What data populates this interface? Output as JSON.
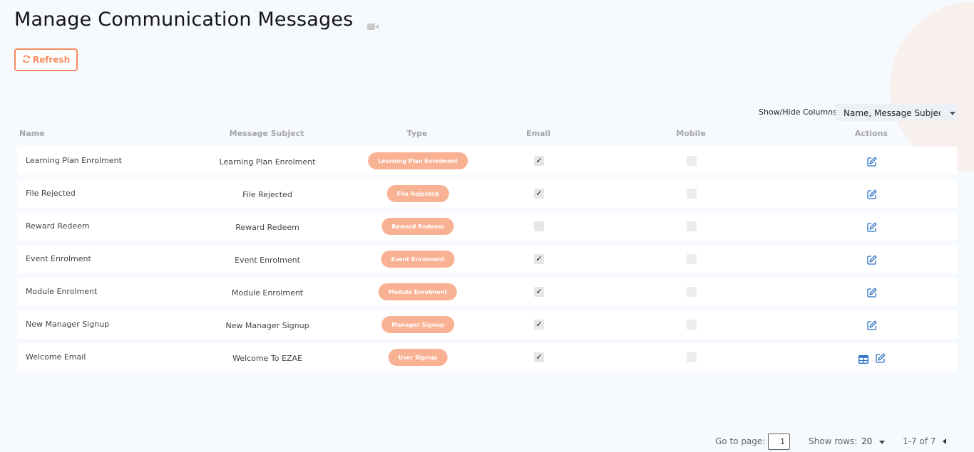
{
  "page": {
    "title": "Manage Communication Messages",
    "title_icon": "video-camera-icon",
    "refresh_label": "Refresh",
    "refresh_icon": "refresh-icon"
  },
  "columns_control": {
    "label": "Show/Hide Columns:",
    "selected": "Name, Message Subject, Ty"
  },
  "table": {
    "headers": [
      "Name",
      "Message Subject",
      "Type",
      "Email",
      "Mobile",
      "Actions"
    ],
    "rows": [
      {
        "name": "Learning Plan Enrolment",
        "subject": "Learning Plan Enrolment",
        "type": "Learning Plan Enrolment",
        "email": true,
        "mobile": false,
        "actions": [
          "edit-icon"
        ]
      },
      {
        "name": "File Rejected",
        "subject": "File Rejected",
        "type": "File Rejected",
        "email": true,
        "mobile": false,
        "actions": [
          "edit-icon"
        ]
      },
      {
        "name": "Reward Redeem",
        "subject": "Reward Redeem",
        "type": "Reward Redeem",
        "email": false,
        "mobile": false,
        "actions": [
          "edit-icon"
        ]
      },
      {
        "name": "Event Enrolment",
        "subject": "Event Enrolment",
        "type": "Event Enrolment",
        "email": true,
        "mobile": false,
        "actions": [
          "edit-icon"
        ]
      },
      {
        "name": "Module Enrolment",
        "subject": "Module Enrolment",
        "type": "Module Enrolment",
        "email": true,
        "mobile": false,
        "actions": [
          "edit-icon"
        ]
      },
      {
        "name": "New Manager Signup",
        "subject": "New Manager Signup",
        "type": "Manager Signup",
        "email": true,
        "mobile": false,
        "actions": [
          "edit-icon"
        ]
      },
      {
        "name": "Welcome Email",
        "subject": "Welcome To EZAE",
        "type": "User Signup",
        "email": true,
        "mobile": false,
        "actions": [
          "table-icon",
          "edit-icon"
        ]
      }
    ]
  },
  "pagination": {
    "go_to_label": "Go to page:",
    "page_value": "1",
    "show_rows_label": "Show rows:",
    "rows_value": "20",
    "range_text": "1-7 of 7"
  },
  "colors": {
    "accent": "#f58a5e",
    "pill": "#f9b193",
    "action_icon": "#2a72c4",
    "background": "#f6f9fd"
  }
}
